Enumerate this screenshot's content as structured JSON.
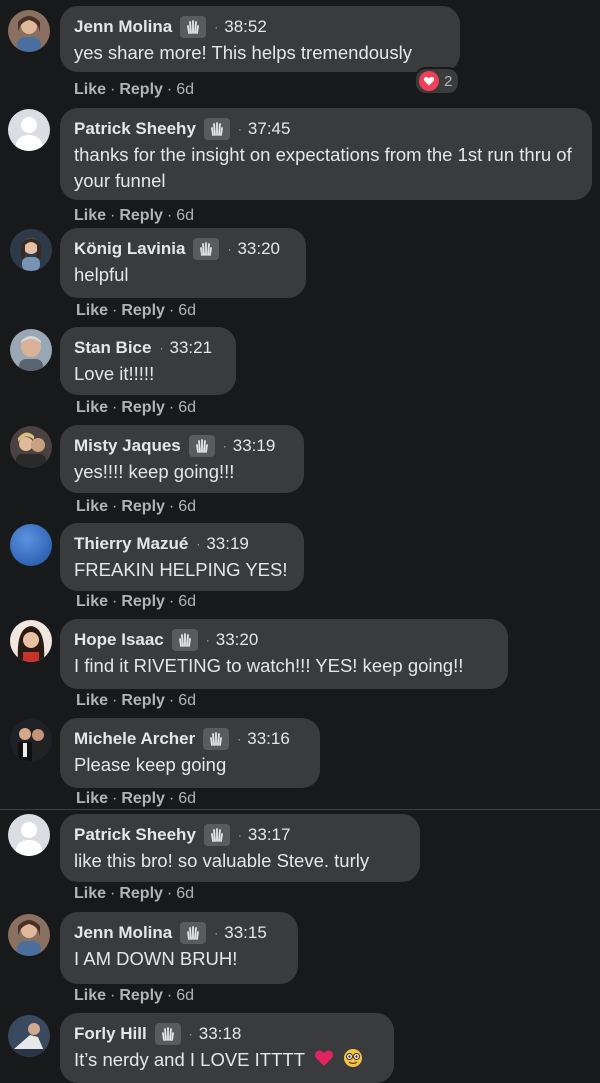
{
  "comments": [
    {
      "name": "Jenn Molina",
      "time": "38:52",
      "text": "yes share more! This helps tremendously",
      "like": "Like",
      "reply": "Reply",
      "age": "6d",
      "reaction_count": "2",
      "avatar_color": "#7a5a4a"
    },
    {
      "name": "Patrick Sheehy",
      "time": "37:45",
      "text": "thanks for the insight on expectations from the 1st run thru of your funnel",
      "like": "Like",
      "reply": "Reply",
      "age": "6d",
      "avatar_color": "#c9ccd1"
    },
    {
      "name": "König Lavinia",
      "time": "33:20",
      "text": "helpful",
      "like": "Like",
      "reply": "Reply",
      "age": "6d",
      "avatar_color": "#4d6075"
    },
    {
      "name": "Stan Bice",
      "time": "33:21",
      "text": "Love it!!!!!",
      "like": "Like",
      "reply": "Reply",
      "age": "6d",
      "avatar_color": "#8d9aa6"
    },
    {
      "name": "Misty Jaques",
      "time": "33:19",
      "text": "yes!!!! keep going!!!",
      "like": "Like",
      "reply": "Reply",
      "age": "6d",
      "avatar_color": "#6b5b55"
    },
    {
      "name": "Thierry Mazué",
      "time": "33:19",
      "text": "FREAKIN HELPING YES!",
      "like": "Like",
      "reply": "Reply",
      "age": "6d",
      "avatar_color": "#3b73c9"
    },
    {
      "name": "Hope Isaac",
      "time": "33:20",
      "text": "I find it RIVETING to watch!!! YES! keep going!!",
      "like": "Like",
      "reply": "Reply",
      "age": "6d",
      "avatar_color": "#3a2a24"
    },
    {
      "name": "Michele Archer",
      "time": "33:16",
      "text": "Please keep going",
      "like": "Like",
      "reply": "Reply",
      "age": "6d",
      "avatar_color": "#2b2f3a"
    },
    {
      "name": "Patrick Sheehy",
      "time": "33:17",
      "text": "like this bro! so valuable Steve. turly",
      "like": "Like",
      "reply": "Reply",
      "age": "6d",
      "avatar_color": "#c9ccd1"
    },
    {
      "name": "Jenn Molina",
      "time": "33:15",
      "text": "I AM DOWN BRUH!",
      "like": "Like",
      "reply": "Reply",
      "age": "6d",
      "avatar_color": "#7a5a4a"
    },
    {
      "name": "Forly Hill",
      "time": "33:18",
      "text": "It’s nerdy and I LOVE ITTTT",
      "like": "Like",
      "reply": "Reply",
      "age": "6d",
      "avatar_color": "#2e3d52"
    }
  ],
  "colors": {
    "background": "#18191a",
    "bubble": "#3a3b3c",
    "text": "#e4e6eb",
    "muted": "#b0b3b8",
    "love": "#f33e58"
  },
  "icons": {
    "badge": "wave-hand-icon",
    "reaction": "heart-icon",
    "emoji_heart": "red-heart-emoji",
    "emoji_nerd": "nerd-face-emoji"
  }
}
